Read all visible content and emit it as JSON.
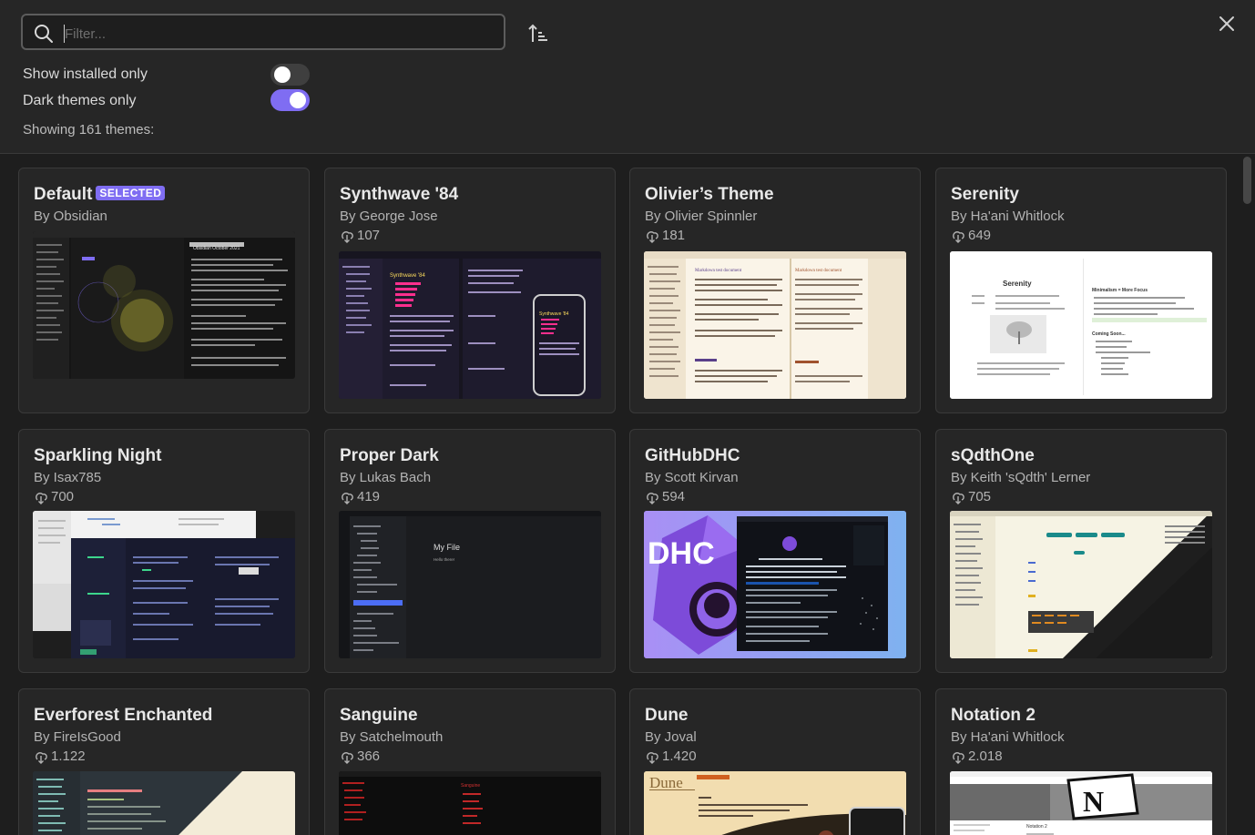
{
  "search": {
    "placeholder": "Filter..."
  },
  "toggles": {
    "installed_label": "Show installed only",
    "installed_on": false,
    "dark_label": "Dark themes only",
    "dark_on": true
  },
  "showing_text": "Showing 161 themes:",
  "accent_color": "#7f6df2",
  "selected_badge": "SELECTED",
  "themes": [
    {
      "name": "Default",
      "author": "By Obsidian",
      "downloads": "",
      "selected": true
    },
    {
      "name": "Synthwave '84",
      "author": "By George Jose",
      "downloads": "107"
    },
    {
      "name": "Olivier’s Theme",
      "author": "By Olivier Spinnler",
      "downloads": "181"
    },
    {
      "name": "Serenity",
      "author": "By Ha'ani Whitlock",
      "downloads": "649"
    },
    {
      "name": "Sparkling Night",
      "author": "By Isax785",
      "downloads": "700"
    },
    {
      "name": "Proper Dark",
      "author": "By Lukas Bach",
      "downloads": "419"
    },
    {
      "name": "GitHubDHC",
      "author": "By Scott Kirvan",
      "downloads": "594"
    },
    {
      "name": "sQdthOne",
      "author": "By Keith 'sQdth' Lerner",
      "downloads": "705"
    },
    {
      "name": "Everforest Enchanted",
      "author": "By FireIsGood",
      "downloads": "1.122"
    },
    {
      "name": "Sanguine",
      "author": "By Satchelmouth",
      "downloads": "366"
    },
    {
      "name": "Dune",
      "author": "By Joval",
      "downloads": "1.420"
    },
    {
      "name": "Notation 2",
      "author": "By Ha'ani Whitlock",
      "downloads": "2.018"
    }
  ],
  "previews": {
    "default_heading": "Obsidian October 2021",
    "synthwave_title": "Synthwave '84",
    "olivier_heading": "Markdown test document",
    "serenity_title": "Serenity",
    "serenity_minimalism": "Minimalism = More Focus",
    "serenity_coming": "Coming Soon...",
    "proper_dark_file": "My File",
    "proper_dark_text": "Hello there!",
    "githubdhc_logo": "DHC",
    "sanguine_title": "Sanguine",
    "dune_logo": "Dune",
    "notation_logo": "N",
    "notation_caption": "Notation 2"
  }
}
